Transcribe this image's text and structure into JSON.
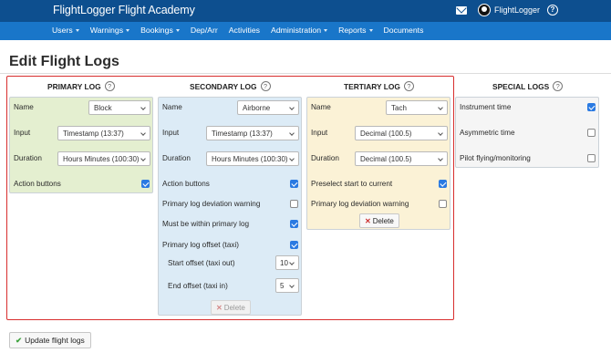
{
  "app": {
    "title": "FlightLogger Flight Academy",
    "user": "FlightLogger",
    "help": "?"
  },
  "nav": [
    {
      "label": "Users",
      "has_menu": true
    },
    {
      "label": "Warnings",
      "has_menu": true
    },
    {
      "label": "Bookings",
      "has_menu": true
    },
    {
      "label": "Dep/Arr",
      "has_menu": false
    },
    {
      "label": "Activities",
      "has_menu": false
    },
    {
      "label": "Administration",
      "has_menu": true
    },
    {
      "label": "Reports",
      "has_menu": true
    },
    {
      "label": "Documents",
      "has_menu": false
    }
  ],
  "page": {
    "title": "Edit Flight Logs"
  },
  "primary": {
    "title": "PRIMARY LOG",
    "help": "?",
    "name_label": "Name",
    "name": "Block",
    "input_label": "Input",
    "input": "Timestamp (13:37)",
    "duration_label": "Duration",
    "duration": "Hours Minutes (100:30)",
    "action_label": "Action buttons",
    "action_checked": true
  },
  "secondary": {
    "title": "SECONDARY LOG",
    "help": "?",
    "name_label": "Name",
    "name": "Airborne",
    "input_label": "Input",
    "input": "Timestamp (13:37)",
    "duration_label": "Duration",
    "duration": "Hours Minutes (100:30)",
    "options": [
      {
        "label": "Action buttons",
        "checked": true
      },
      {
        "label": "Primary log deviation warning",
        "checked": false
      },
      {
        "label": "Must be within primary log",
        "checked": true
      },
      {
        "label": "Primary log offset (taxi)",
        "checked": true
      }
    ],
    "start_offset_label": "Start offset (taxi out)",
    "start_offset": "10",
    "end_offset_label": "End offset (taxi in)",
    "end_offset": "5",
    "delete_label": "Delete"
  },
  "tertiary": {
    "title": "TERTIARY LOG",
    "help": "?",
    "name_label": "Name",
    "name": "Tach",
    "input_label": "Input",
    "input": "Decimal (100.5)",
    "duration_label": "Duration",
    "duration": "Decimal (100.5)",
    "options": [
      {
        "label": "Preselect start to current",
        "checked": true
      },
      {
        "label": "Primary log deviation warning",
        "checked": false
      }
    ],
    "delete_label": "Delete"
  },
  "special": {
    "title": "SPECIAL LOGS",
    "help": "?",
    "options": [
      {
        "label": "Instrument time",
        "checked": true
      },
      {
        "label": "Asymmetric time",
        "checked": false
      },
      {
        "label": "Pilot flying/monitoring",
        "checked": false
      }
    ]
  },
  "actions": {
    "update_label": "Update flight logs"
  },
  "colors": {
    "topbar": "#0d4f8f",
    "navbar": "#1976c9",
    "primary_panel": "#e4efd0",
    "secondary_panel": "#dcebf6",
    "tertiary_panel": "#fbf2d6",
    "special_panel": "#f5f5f5",
    "highlight_border": "#d82e2e",
    "checkbox": "#2a7ae2"
  }
}
